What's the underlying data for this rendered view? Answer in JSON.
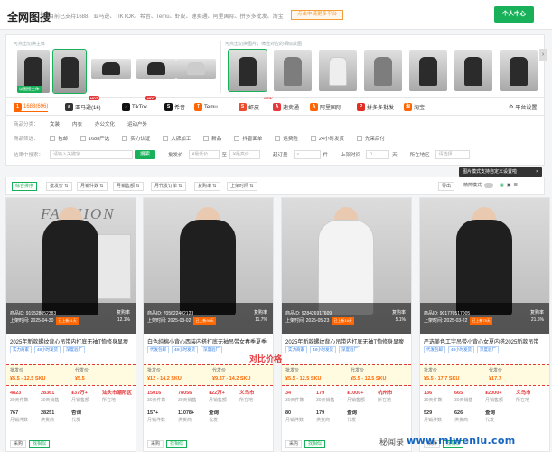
{
  "header": {
    "logo": "全网图搜",
    "subtitle": "目前已支持1688、亚马逊、TIKTOK、希音、Temu、虾皮、速卖通、阿里国际、拼多多批发、淘宝",
    "apply_label": "点击申请更多平台",
    "user_label": "个人中心"
  },
  "upload": {
    "caption": "可点击切换主体",
    "selected_tag": "以图搜主体"
  },
  "results_caption": "可点击切换图片，筛选对应的相似款图",
  "platforms": [
    {
      "label": "1688(696)",
      "color": "#f60",
      "glyph": "1"
    },
    {
      "label": "亚马逊(16)",
      "color": "#333",
      "glyph": "a",
      "badge": "HOT"
    },
    {
      "label": "TikTok",
      "color": "#111",
      "glyph": "♪",
      "badge": "HOT"
    },
    {
      "label": "希音",
      "color": "#111",
      "glyph": "S"
    },
    {
      "label": "Temu",
      "color": "#f60",
      "glyph": "T"
    },
    {
      "label": "虾皮",
      "color": "#ee4d2d",
      "glyph": "S",
      "badge": "NEW"
    },
    {
      "label": "速卖通",
      "color": "#e4393c",
      "glyph": "A"
    },
    {
      "label": "阿里国际",
      "color": "#f60",
      "glyph": "A"
    },
    {
      "label": "拼多多批发",
      "color": "#e02e24",
      "glyph": "P"
    },
    {
      "label": "淘宝",
      "color": "#f60",
      "glyph": "淘"
    }
  ],
  "platform_right": "平台设置",
  "filters": {
    "category_label": "商品分类：",
    "categories": [
      "女装",
      "内衣",
      "办公文化",
      "运动户外"
    ],
    "screen_label": "商品筛选：",
    "screens": [
      "包邮",
      "1688严选",
      "实力认证",
      "大牌加工",
      "新品",
      "抖音面单",
      "运费险",
      "24小时发货",
      "先采后付"
    ],
    "result_label": "结果中搜索：",
    "result_placeholder": "请输入关键字",
    "search_label": "搜索",
    "price_label": "批发价",
    "price_min": "¥最低价",
    "price_to": "至",
    "price_max": "¥最高价",
    "moq_label": "起订量",
    "moq_from": "≤",
    "moq_unit": "件",
    "days_label": "上架时间",
    "days_from": "0",
    "days_to": "天",
    "region_label": "所在地区",
    "region_placeholder": "请选择"
  },
  "tooltip": "图片模式支持自定义设置啦",
  "sort": {
    "items": [
      "综合排序",
      "批发价",
      "月销件数",
      "月销售额",
      "月代发订单",
      "复购率",
      "上架时间"
    ],
    "export": "导出",
    "mode_label": "精简模式"
  },
  "compare_label": "对比价格",
  "cards": [
    {
      "style": "fashion",
      "id": "商品ID: 919528052383",
      "listed": "上架时间: 2025-04-30",
      "promo": "已上新41天",
      "rebuy_label": "复购率",
      "rebuy": "12.1%",
      "title": "2025年新款螺纹背心吊带内打底无袖T恤修身显瘦",
      "tags": [
        "实力商家",
        "48小时发货",
        "深度验厂"
      ],
      "pf_label": "批发价",
      "pf_val": "¥5.5 - 12.5 SKU",
      "df_label": "代发价",
      "df_val": "¥5.5",
      "stats": [
        [
          {
            "v": "4823",
            "k": "30天件数"
          },
          {
            "v": "28361",
            "k": "30天销售"
          },
          {
            "v": "¥37万+",
            "k": "月销售额"
          },
          {
            "v": "汕头市潮阳区",
            "k": "所在地"
          }
        ],
        [
          {
            "v": "767",
            "k": "月销件数",
            "d": true
          },
          {
            "v": "28251",
            "k": "供货商",
            "d": true
          },
          {
            "v": "杏询",
            "k": "代发",
            "d": true
          },
          {
            "v": "",
            "k": "",
            "d": true
          }
        ]
      ],
      "actions": [
        "采购",
        "找相似"
      ]
    },
    {
      "style": "dark",
      "id": "商品ID: 705622402123",
      "listed": "上架时间: 2025-03-02",
      "promo": "已上新98天",
      "rebuy_label": "复购率",
      "rebuy": "11.7%",
      "title": "白色纯棉小背心西装内搭打底无袖吊带女春季夏季",
      "tags": [
        "代发包邮",
        "48小时发货",
        "深度验厂"
      ],
      "pf_label": "批发价",
      "pf_val": "¥12 - 14.2 SKU",
      "df_label": "代发价",
      "df_val": "¥9.37 - 14.2 SKU",
      "stats": [
        [
          {
            "v": "15016",
            "k": "30天件数"
          },
          {
            "v": "78056",
            "k": "30天销售"
          },
          {
            "v": "¥22万+",
            "k": "月销售额"
          },
          {
            "v": "义乌市",
            "k": "所在地"
          }
        ],
        [
          {
            "v": "157+",
            "k": "月销件数",
            "d": true
          },
          {
            "v": "11078+",
            "k": "供货商",
            "d": true
          },
          {
            "v": "查询",
            "k": "代发",
            "d": true
          },
          {
            "v": "",
            "k": "",
            "d": true
          }
        ]
      ],
      "actions": [
        "采购",
        "找相似"
      ]
    },
    {
      "style": "white",
      "id": "商品ID: 928426917609",
      "listed": "上架时间: 2025-05-23",
      "promo": "已上新18天",
      "rebuy_label": "复购率",
      "rebuy": "5.1%",
      "title": "2025年新款螺纹背心吊带内打底无袖T恤修身显瘦",
      "tags": [
        "实力商家",
        "48小时发货",
        "深度验厂"
      ],
      "pf_label": "批发价",
      "pf_val": "¥5.5 - 12.5 SKU",
      "df_label": "代发价",
      "df_val": "¥5.5 - 12.5 SKU",
      "stats": [
        [
          {
            "v": "34",
            "k": "30天件数"
          },
          {
            "v": "179",
            "k": "30天销售"
          },
          {
            "v": "¥1000+",
            "k": "月销售额"
          },
          {
            "v": "杭州市",
            "k": "所在地"
          }
        ],
        [
          {
            "v": "80",
            "k": "月销件数",
            "d": true
          },
          {
            "v": "179",
            "k": "供货商",
            "d": true
          },
          {
            "v": "查询",
            "k": "代发",
            "d": true
          },
          {
            "v": "",
            "k": "",
            "d": true
          }
        ]
      ],
      "actions": [
        "采购",
        "找相似"
      ]
    },
    {
      "style": "dark",
      "id": "商品ID: 901770517005",
      "listed": "上架时间: 2025-03-22",
      "promo": "已上新78天",
      "rebuy_label": "复购率",
      "rebuy": "21.6%",
      "title": "严选美色工字吊带小背心女夏内搭2025新款吊带",
      "tags": [
        "代发包邮",
        "48小时发货",
        "深度验厂"
      ],
      "pf_label": "批发价",
      "pf_val": "¥5.5 - 17.7 SKU",
      "df_label": "代发价",
      "df_val": "¥17.7",
      "stats": [
        [
          {
            "v": "136",
            "k": "30天件数"
          },
          {
            "v": "665",
            "k": "30天销售"
          },
          {
            "v": "¥2000+",
            "k": "月销售额"
          },
          {
            "v": "义乌市",
            "k": "所在地"
          }
        ],
        [
          {
            "v": "529",
            "k": "月销件数",
            "d": true
          },
          {
            "v": "626",
            "k": "供货商",
            "d": true
          },
          {
            "v": "查询",
            "k": "代发",
            "d": true
          },
          {
            "v": "",
            "k": "",
            "d": true
          }
        ]
      ],
      "actions": [
        "采购",
        "找相似"
      ]
    }
  ],
  "watermark": "www.miwenlu.com",
  "watermark_cn": "秘闻录"
}
